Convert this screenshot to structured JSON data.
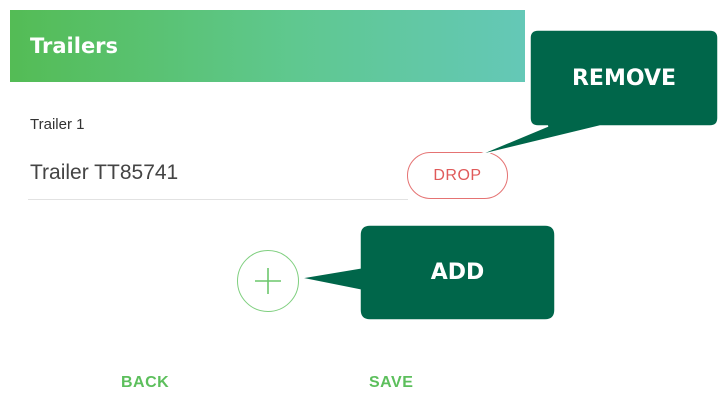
{
  "header": {
    "title": "Trailers"
  },
  "trailer_field": {
    "label": "Trailer 1",
    "value": "Trailer TT85741",
    "drop_label": "DROP"
  },
  "add_button": {
    "icon": "plus-icon"
  },
  "footer": {
    "back_label": "BACK",
    "save_label": "SAVE"
  },
  "callouts": {
    "remove_label": "REMOVE",
    "add_label": "ADD",
    "color": "#00664a"
  },
  "colors": {
    "header_gradient_start": "#54bc55",
    "header_gradient_end": "#64c8b7",
    "drop_red": "#e05a5a",
    "action_green": "#5cbf5c"
  }
}
